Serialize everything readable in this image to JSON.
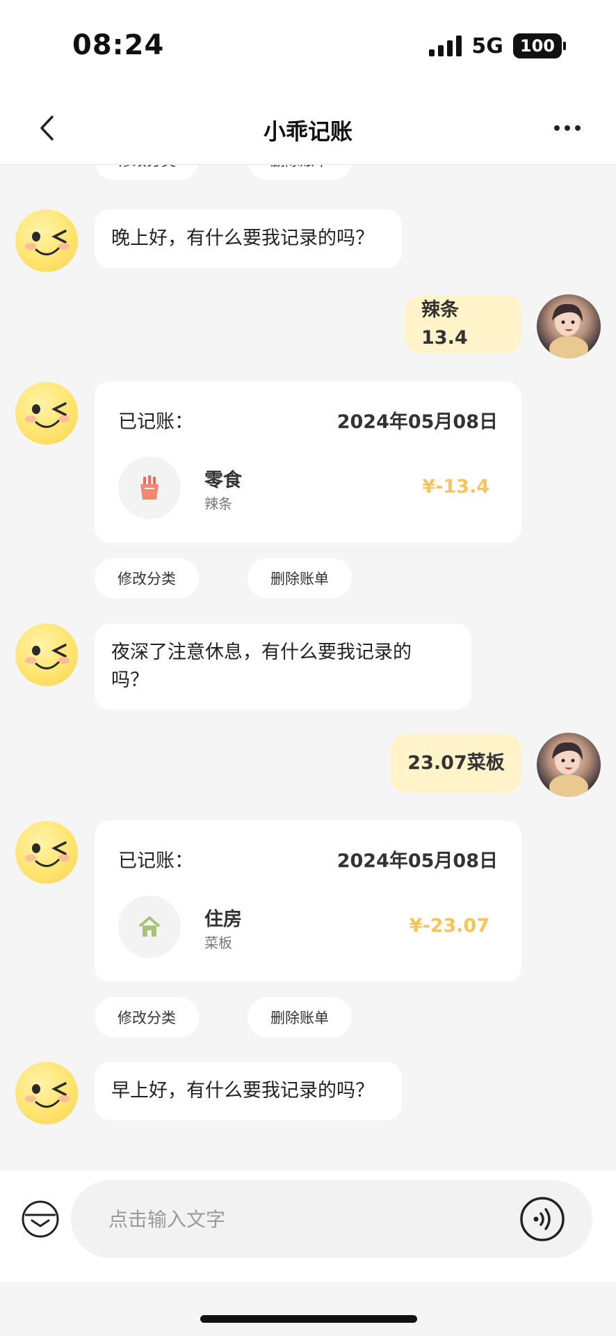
{
  "status_bar": {
    "time": "08:24",
    "network": "5G",
    "battery": "100"
  },
  "nav": {
    "title": "小乖记账",
    "back_icon": "chevron-left-icon",
    "more_icon": "more-dots-icon"
  },
  "partial_actions": {
    "edit_label": "修改分类",
    "delete_label": "删除账单"
  },
  "messages": [
    {
      "type": "bot",
      "text": "晚上好，有什么要我记录的吗？"
    },
    {
      "type": "user",
      "text": "辣条13.4"
    },
    {
      "type": "record",
      "label": "已记账：",
      "date": "2024年05月08日",
      "category": "零食",
      "category_icon": "fries-icon",
      "note": "辣条",
      "amount": "¥-13.4",
      "edit_label": "修改分类",
      "delete_label": "删除账单"
    },
    {
      "type": "bot",
      "text_line1": "夜深了注意休息，有什么要我记录的",
      "text_line2": "吗？"
    },
    {
      "type": "user",
      "text": "23.07菜板"
    },
    {
      "type": "record",
      "label": "已记账：",
      "date": "2024年05月08日",
      "category": "住房",
      "category_icon": "house-icon",
      "note": "菜板",
      "amount": "¥-23.07",
      "edit_label": "修改分类",
      "delete_label": "删除账单"
    },
    {
      "type": "bot",
      "text": "早上好，有什么要我记录的吗？"
    }
  ],
  "input": {
    "placeholder": "点击输入文字",
    "keyboard_icon": "keyboard-toggle-icon",
    "voice_icon": "voice-icon"
  },
  "colors": {
    "accent_amount": "#f5c45a",
    "user_bubble": "#fff3c9",
    "background": "#f5f5f5"
  }
}
